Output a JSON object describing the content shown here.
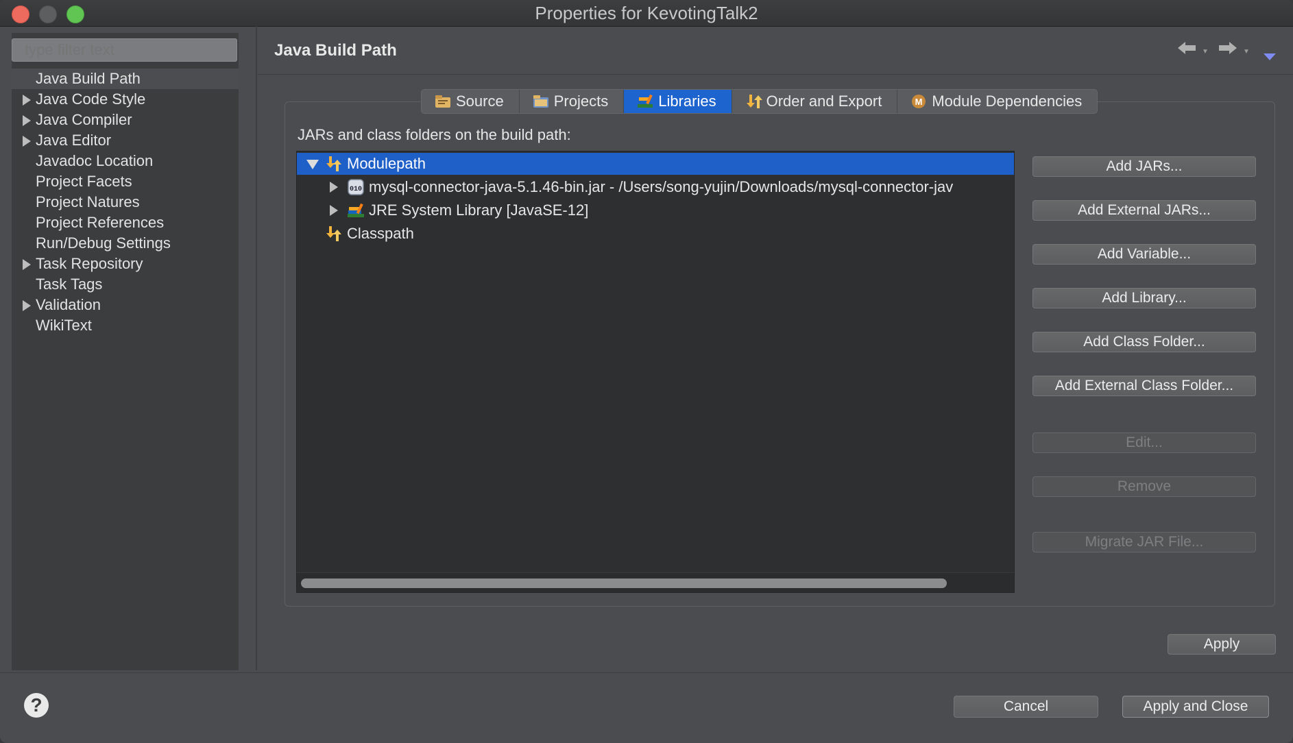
{
  "window": {
    "title": "Properties for KevotingTalk2"
  },
  "sidebar": {
    "filter_placeholder": "type filter text",
    "items": [
      {
        "label": "Java Build Path",
        "expandable": false,
        "selected": true
      },
      {
        "label": "Java Code Style",
        "expandable": true
      },
      {
        "label": "Java Compiler",
        "expandable": true
      },
      {
        "label": "Java Editor",
        "expandable": true
      },
      {
        "label": "Javadoc Location",
        "expandable": false
      },
      {
        "label": "Project Facets",
        "expandable": false
      },
      {
        "label": "Project Natures",
        "expandable": false
      },
      {
        "label": "Project References",
        "expandable": false
      },
      {
        "label": "Run/Debug Settings",
        "expandable": false
      },
      {
        "label": "Task Repository",
        "expandable": true
      },
      {
        "label": "Task Tags",
        "expandable": false
      },
      {
        "label": "Validation",
        "expandable": true
      },
      {
        "label": "WikiText",
        "expandable": false
      }
    ]
  },
  "page": {
    "title": "Java Build Path",
    "tabs": [
      {
        "label": "Source",
        "icon": "source-folder-icon"
      },
      {
        "label": "Projects",
        "icon": "projects-folder-icon"
      },
      {
        "label": "Libraries",
        "icon": "library-books-icon",
        "active": true
      },
      {
        "label": "Order and Export",
        "icon": "order-export-icon"
      },
      {
        "label": "Module Dependencies",
        "icon": "module-icon"
      }
    ],
    "description": "JARs and class folders on the build path:",
    "tree": {
      "modulepath": "Modulepath",
      "jar": "mysql-connector-java-5.1.46-bin.jar - /Users/song-yujin/Downloads/mysql-connector-jav",
      "jre": "JRE System Library [JavaSE-12]",
      "classpath": "Classpath"
    },
    "buttons": {
      "add_jars": "Add JARs...",
      "add_external_jars": "Add External JARs...",
      "add_variable": "Add Variable...",
      "add_library": "Add Library...",
      "add_class_folder": "Add Class Folder...",
      "add_external_class_folder": "Add External Class Folder...",
      "edit": "Edit...",
      "remove": "Remove",
      "migrate_jar": "Migrate JAR File...",
      "apply": "Apply"
    }
  },
  "footer": {
    "help": "?",
    "cancel": "Cancel",
    "apply_close": "Apply and Close"
  },
  "colors": {
    "selection": "#1f5fc8",
    "active_tab": "#1e64cf",
    "close": "#ed6a5e",
    "zoom": "#61c554"
  }
}
